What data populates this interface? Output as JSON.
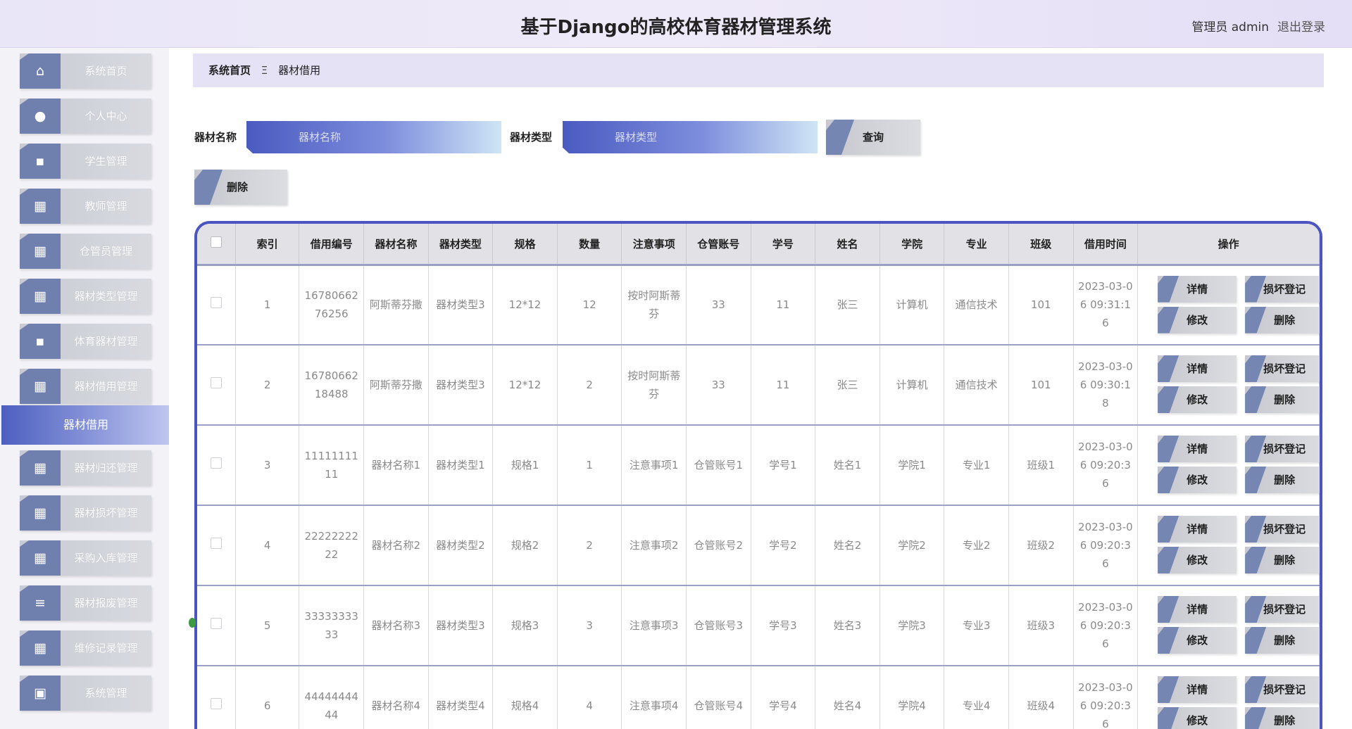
{
  "header": {
    "title": "基于Django的高校体育器材管理系统",
    "user": "管理员 admin",
    "logout": "退出登录"
  },
  "sidebar": {
    "items": [
      {
        "label": "系统首页",
        "icon": "home-icon",
        "glyph": "⌂"
      },
      {
        "label": "个人中心",
        "icon": "user-icon",
        "glyph": "●"
      },
      {
        "label": "学生管理",
        "icon": "chat-icon",
        "glyph": "▪"
      },
      {
        "label": "教师管理",
        "icon": "grid-icon",
        "glyph": "▦"
      },
      {
        "label": "仓管员管理",
        "icon": "grid-icon",
        "glyph": "▦"
      },
      {
        "label": "器材类型管理",
        "icon": "grid-icon",
        "glyph": "▦"
      },
      {
        "label": "体育器材管理",
        "icon": "chat-icon",
        "glyph": "▪"
      },
      {
        "label": "器材借用管理",
        "icon": "grid-icon",
        "glyph": "▦"
      }
    ],
    "active_sub": "器材借用",
    "items_after": [
      {
        "label": "器材归还管理",
        "icon": "grid-icon",
        "glyph": "▦"
      },
      {
        "label": "器材损坏管理",
        "icon": "grid-icon",
        "glyph": "▦"
      },
      {
        "label": "采购入库管理",
        "icon": "grid-icon",
        "glyph": "▦"
      },
      {
        "label": "器材报废管理",
        "icon": "list-icon",
        "glyph": "≡"
      },
      {
        "label": "维修记录管理",
        "icon": "grid-icon",
        "glyph": "▦"
      },
      {
        "label": "系统管理",
        "icon": "monitor-icon",
        "glyph": "▣"
      }
    ]
  },
  "breadcrumb": {
    "home": "系统首页",
    "separator": "Ξ",
    "current": "器材借用"
  },
  "search": {
    "name_label": "器材名称",
    "name_placeholder": "器材名称",
    "type_label": "器材类型",
    "type_placeholder": "器材类型",
    "query_button": "查询",
    "delete_button": "删除"
  },
  "table": {
    "headers": [
      "索引",
      "借用编号",
      "器材名称",
      "器材类型",
      "规格",
      "数量",
      "注意事项",
      "仓管账号",
      "学号",
      "姓名",
      "学院",
      "专业",
      "班级",
      "借用时间",
      "操作"
    ],
    "rows": [
      [
        "1",
        "1678066276256",
        "阿斯蒂芬撒",
        "器材类型3",
        "12*12",
        "12",
        "按时阿斯蒂芬",
        "33",
        "11",
        "张三",
        "计算机",
        "通信技术",
        "101",
        "2023-03-06 09:31:16"
      ],
      [
        "2",
        "1678066218488",
        "阿斯蒂芬撒",
        "器材类型3",
        "12*12",
        "2",
        "按时阿斯蒂芬",
        "33",
        "11",
        "张三",
        "计算机",
        "通信技术",
        "101",
        "2023-03-06 09:30:18"
      ],
      [
        "3",
        "1111111111",
        "器材名称1",
        "器材类型1",
        "规格1",
        "1",
        "注意事项1",
        "仓管账号1",
        "学号1",
        "姓名1",
        "学院1",
        "专业1",
        "班级1",
        "2023-03-06 09:20:36"
      ],
      [
        "4",
        "2222222222",
        "器材名称2",
        "器材类型2",
        "规格2",
        "2",
        "注意事项2",
        "仓管账号2",
        "学号2",
        "姓名2",
        "学院2",
        "专业2",
        "班级2",
        "2023-03-06 09:20:36"
      ],
      [
        "5",
        "3333333333",
        "器材名称3",
        "器材类型3",
        "规格3",
        "3",
        "注意事项3",
        "仓管账号3",
        "学号3",
        "姓名3",
        "学院3",
        "专业3",
        "班级3",
        "2023-03-06 09:20:36"
      ],
      [
        "6",
        "4444444444",
        "器材名称4",
        "器材类型4",
        "规格4",
        "4",
        "注意事项4",
        "仓管账号4",
        "学号4",
        "姓名4",
        "学院4",
        "专业4",
        "班级4",
        "2023-03-06 09:20:36"
      ]
    ],
    "actions": {
      "detail": "详情",
      "damage": "损坏登记",
      "edit": "修改",
      "delete": "删除"
    }
  },
  "colors": {
    "accent": "#4a55c2",
    "menu_icon": "#6f7fae",
    "active_menu": "#4d5fbf"
  }
}
